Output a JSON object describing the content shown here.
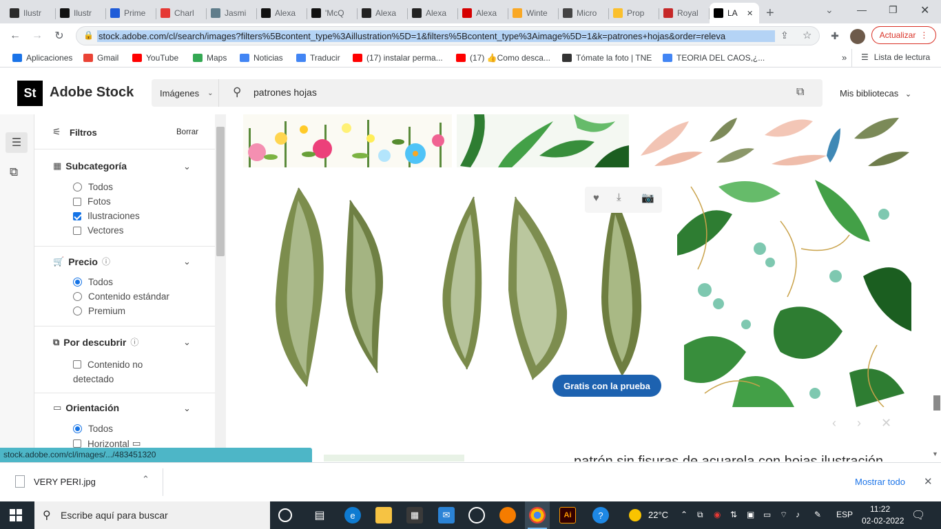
{
  "browser": {
    "tabs": [
      {
        "title": "Ilustr",
        "icon": "threads-icon",
        "color": "#2b2b2b"
      },
      {
        "title": "Ilustr",
        "icon": "letterboxd-icon",
        "color": "#111111"
      },
      {
        "title": "Prime",
        "icon": "flag-icon",
        "color": "#1e5bd8"
      },
      {
        "title": "Charl",
        "icon": "home-icon",
        "color": "#e53935"
      },
      {
        "title": "Jasmi",
        "icon": "thumbs-icon",
        "color": "#607d8b"
      },
      {
        "title": "Alexa",
        "icon": "vogue-icon",
        "color": "#111111"
      },
      {
        "title": "'McQ",
        "icon": "vogue-icon",
        "color": "#111111"
      },
      {
        "title": "Alexa",
        "icon": "slash-circle-icon",
        "color": "#222222"
      },
      {
        "title": "Alexa",
        "icon": "slash-circle-icon",
        "color": "#222222"
      },
      {
        "title": "Alexa",
        "icon": "red-square-icon",
        "color": "#d50000"
      },
      {
        "title": "Winte",
        "icon": "orange-circle-icon",
        "color": "#f9a825"
      },
      {
        "title": "Micro",
        "icon": "globe-icon",
        "color": "#444444"
      },
      {
        "title": "Prop",
        "icon": "note-icon",
        "color": "#fbc02d"
      },
      {
        "title": "Royal",
        "icon": "pdf-icon",
        "color": "#c62828"
      },
      {
        "title": "LA",
        "icon": "adobe-stock-icon",
        "color": "#000000",
        "active": true
      }
    ],
    "url": "stock.adobe.com/cl/search/images?filters%5Bcontent_type%3Aillustration%5D=1&filters%5Bcontent_type%3Aimage%5D=1&k=patrones+hojas&order=releva",
    "update_label": "Actualizar",
    "bookmarks": [
      {
        "label": "Aplicaciones",
        "color": "#1a73e8"
      },
      {
        "label": "Gmail",
        "color": "#ea4335"
      },
      {
        "label": "YouTube",
        "color": "#ff0000"
      },
      {
        "label": "Maps",
        "color": "#34a853"
      },
      {
        "label": "Noticias",
        "color": "#4285f4"
      },
      {
        "label": "Traducir",
        "color": "#4285f4"
      },
      {
        "label": "(17) instalar perma...",
        "color": "#ff0000"
      },
      {
        "label": "(17) 👍Como desca...",
        "color": "#ff0000"
      },
      {
        "label": "Tómate la foto | TNE",
        "color": "#333333"
      },
      {
        "label": "TEORIA DEL CAOS,¿...",
        "color": "#4285f4"
      }
    ],
    "reading_list": "Lista de lectura",
    "status_url": "stock.adobe.com/cl/images/.../483451320"
  },
  "site": {
    "logo": "St",
    "brand": "Adobe Stock",
    "category": "Imágenes",
    "query": "patrones hojas",
    "libraries": "Mis bibliotecas"
  },
  "filters": {
    "title": "Filtros",
    "clear": "Borrar",
    "subcategory": {
      "title": "Subcategoría",
      "options": [
        {
          "label": "Todos",
          "type": "radio",
          "checked": false
        },
        {
          "label": "Fotos",
          "type": "check",
          "checked": false
        },
        {
          "label": "Ilustraciones",
          "type": "check",
          "checked": true
        },
        {
          "label": "Vectores",
          "type": "check",
          "checked": false
        }
      ]
    },
    "price": {
      "title": "Precio",
      "options": [
        {
          "label": "Todos",
          "checked": true
        },
        {
          "label": "Contenido estándar",
          "checked": false
        },
        {
          "label": "Premium",
          "checked": false
        }
      ]
    },
    "discover": {
      "title": "Por descubrir",
      "option": "Contenido no detectado"
    },
    "orientation": {
      "title": "Orientación",
      "options": [
        {
          "label": "Todos",
          "checked": true
        },
        {
          "label": "Horizontal",
          "checked": false
        }
      ]
    }
  },
  "results": {
    "free_trial": "Gratis con la prueba",
    "partial_text": "patrón sin fisuras de acuarela con hojas ilustración"
  },
  "download_bar": {
    "file": "VERY PERI.jpg",
    "show_all": "Mostrar todo"
  },
  "taskbar": {
    "search_placeholder": "Escribe aquí para buscar",
    "weather": "22°C",
    "lang": "ESP",
    "time": "11:22",
    "date": "02-02-2022"
  }
}
